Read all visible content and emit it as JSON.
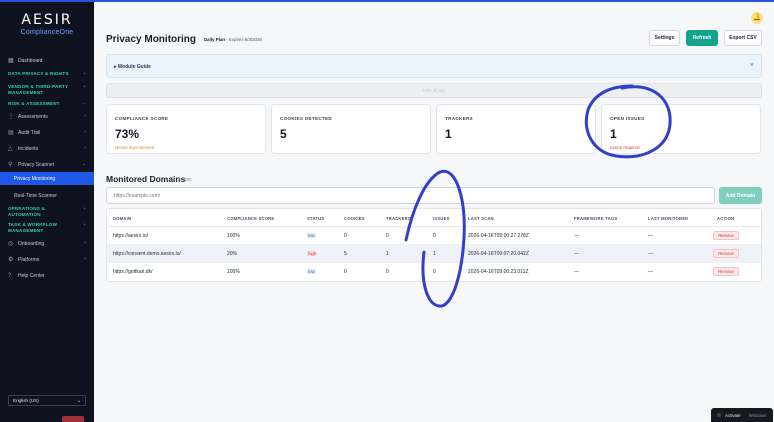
{
  "app": {
    "logo": "AESIR",
    "logo_sub": "ComplianceOne"
  },
  "sidebar": {
    "items": [
      {
        "type": "item",
        "label": "Dashboard",
        "icon": "dashboard-icon"
      },
      {
        "type": "section",
        "label": "DATA PRIVACY & RIGHTS"
      },
      {
        "type": "section",
        "label": "VENDOR & THIRD-PARTY MANAGEMENT"
      },
      {
        "type": "section",
        "label": "RISK & ASSESSMENT"
      },
      {
        "type": "item",
        "label": "Assessments",
        "icon": "checklist-icon"
      },
      {
        "type": "item",
        "label": "Audit Trail",
        "icon": "document-icon"
      },
      {
        "type": "item",
        "label": "Incidents",
        "icon": "warning-icon"
      },
      {
        "type": "item",
        "label": "Privacy Scanner",
        "icon": "search-icon"
      },
      {
        "type": "sub-active",
        "label": "Privacy Monitoring"
      },
      {
        "type": "sub",
        "label": "Real-Time Scanner"
      },
      {
        "type": "section",
        "label": "OPERATIONS & AUTOMATION"
      },
      {
        "type": "section",
        "label": "TASK & WORKFLOW MANAGEMENT"
      },
      {
        "type": "item",
        "label": "Onboarding",
        "icon": "onboarding-icon"
      },
      {
        "type": "item",
        "label": "Platforms",
        "icon": "platform-icon"
      },
      {
        "type": "item",
        "label": "Help Center",
        "icon": "help-icon"
      }
    ],
    "language": "English (US)"
  },
  "header": {
    "title": "Privacy Monitoring",
    "plan_label": "Daily Plan",
    "plan_expiry": "· Expires 6/3/2026",
    "settings_label": "Settings",
    "refresh_label": "Refresh",
    "export_label": "Export CSV"
  },
  "guide": {
    "label": "Module Guide",
    "close": "×"
  },
  "hidebar": {
    "label": "Hide all tips"
  },
  "cards": [
    {
      "label": "COMPLIANCE SCORE",
      "value": "73%",
      "sub": "Needs improvement",
      "sub_color": "#e0832a"
    },
    {
      "label": "COOKIES DETECTED",
      "value": "5",
      "sub": "",
      "sub_color": "#7a8090"
    },
    {
      "label": "TRACKERS",
      "value": "1",
      "sub": "",
      "sub_color": "#7a8090"
    },
    {
      "label": "OPEN ISSUES",
      "value": "1",
      "sub": "Action required",
      "sub_color": "#d23a3a"
    }
  ],
  "domains": {
    "title": "Monitored Domains",
    "count": "3 / 100",
    "input_placeholder": "https://example.com/",
    "add_label": "Add Domain",
    "columns": [
      "DOMAIN",
      "COMPLIANCE SCORE",
      "STATUS",
      "COOKIES",
      "TRACKERS",
      "ISSUES",
      "LAST SCAN",
      "FRAMEWORK TAGS",
      "LAST MONITORED",
      "ACTION"
    ],
    "rows": [
      {
        "domain": "https://aesirx.io/",
        "score": "100%",
        "status": "low",
        "cookies": "0",
        "trackers": "0",
        "issues": "0",
        "last_scan": "2026-04-16T09:00:27.278Z",
        "tags": "—",
        "monitored": "—",
        "action": "Remove"
      },
      {
        "domain": "https://consent.demo.aesirx.io/",
        "score": "20%",
        "status": "high",
        "cookies": "5",
        "trackers": "1",
        "issues": "1",
        "last_scan": "2026-04-16T09:07:20.042Z",
        "tags": "—",
        "monitored": "—",
        "action": "Remove"
      },
      {
        "domain": "https://gottkari.dk/",
        "score": "100%",
        "status": "low",
        "cookies": "0",
        "trackers": "0",
        "issues": "0",
        "last_scan": "2026-04-16T09:00:23.011Z",
        "tags": "—",
        "monitored": "—",
        "action": "Remove"
      }
    ]
  },
  "toast": {
    "label": "Activate",
    "sub": "Windows"
  },
  "colors": {
    "accent": "#1f57e6",
    "primary_button": "#14a38b",
    "annotation": "#3140c8"
  }
}
